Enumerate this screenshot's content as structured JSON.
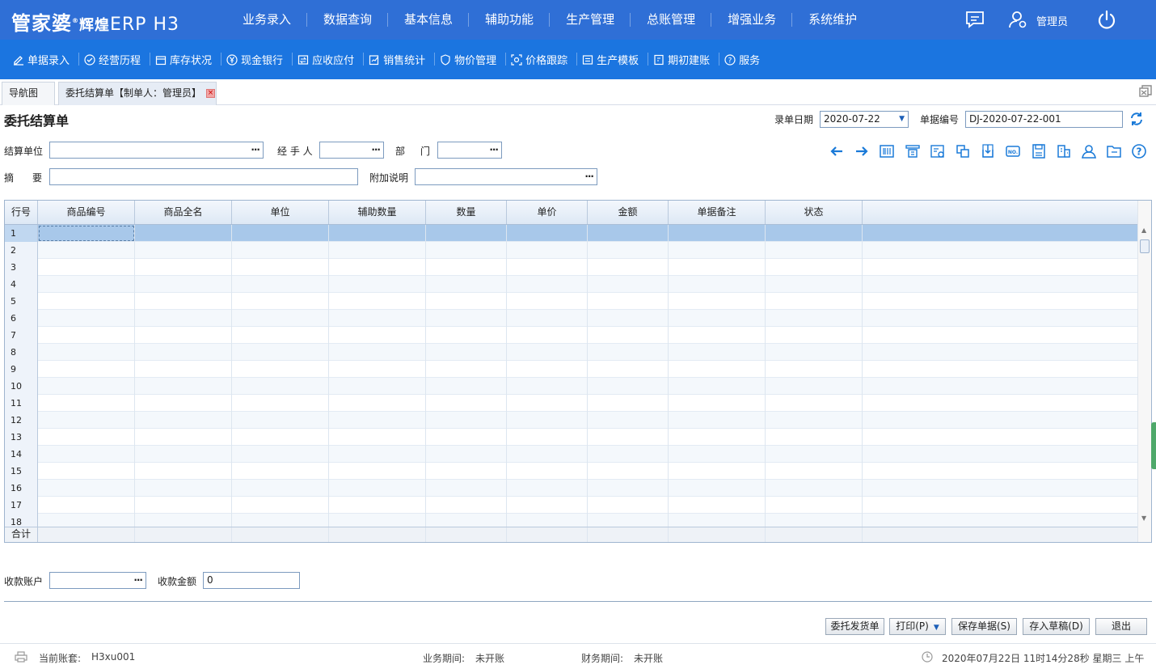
{
  "app": {
    "logo_cn": "管家婆",
    "logo_cn2": "辉煌",
    "logo_erp": "ERP H3",
    "user": "管理员"
  },
  "mainmenu": [
    "业务录入",
    "数据查询",
    "基本信息",
    "辅助功能",
    "生产管理",
    "总账管理",
    "增强业务",
    "系统维护"
  ],
  "toolbar": [
    {
      "label": "单据录入",
      "icon": "edit-icon"
    },
    {
      "label": "经营历程",
      "icon": "check-circle-icon"
    },
    {
      "label": "库存状况",
      "icon": "box-icon"
    },
    {
      "label": "现金银行",
      "icon": "yen-circle-icon"
    },
    {
      "label": "应收应付",
      "icon": "exchange-icon"
    },
    {
      "label": "销售统计",
      "icon": "chart-edit-icon"
    },
    {
      "label": "物价管理",
      "icon": "shield-icon"
    },
    {
      "label": "价格跟踪",
      "icon": "target-icon"
    },
    {
      "label": "生产模板",
      "icon": "template-icon"
    },
    {
      "label": "期初建账",
      "icon": "ledger-icon"
    },
    {
      "label": "服务",
      "icon": "help-icon"
    }
  ],
  "tabs": {
    "nav": "导航图",
    "doc": "委托结算单【制单人：管理员】"
  },
  "form": {
    "title": "委托结算单",
    "date_label": "录单日期",
    "date_value": "2020-07-22",
    "no_label": "单据编号",
    "no_value": "DJ-2020-07-22-001",
    "unit_label": "结算单位",
    "unit_value": "",
    "handler_label": "经 手 人",
    "handler_value": "",
    "dept_label1": "部",
    "dept_label2": "门",
    "dept_value": "",
    "summary_label1": "摘",
    "summary_label2": "要",
    "summary_value": "",
    "note_label": "附加说明",
    "note_value": "",
    "account_label": "收款账户",
    "account_value": "",
    "amount_label": "收款金额",
    "amount_value": "0"
  },
  "grid": {
    "columns": [
      "行号",
      "商品编号",
      "商品全名",
      "单位",
      "辅助数量",
      "数量",
      "单价",
      "金额",
      "单据备注",
      "状态"
    ],
    "rows": [
      "1",
      "2",
      "3",
      "4",
      "5",
      "6",
      "7",
      "8",
      "9",
      "10",
      "11",
      "12",
      "13",
      "14",
      "15",
      "16",
      "17",
      "18"
    ],
    "footer": "合计"
  },
  "buttons": {
    "consign": "委托发货单",
    "print": "打印(P)",
    "save": "保存单据(S)",
    "draft": "存入草稿(D)",
    "exit": "退出"
  },
  "status": {
    "account_label": "当前账套:",
    "account_value": "H3xu001",
    "biz_label": "业务期间:",
    "biz_value": "未开账",
    "fin_label": "财务期间:",
    "fin_value": "未开账",
    "datetime": "2020年07月22日 11时14分28秒 星期三 上午"
  },
  "colors": {
    "header": "#2f6fd6",
    "toolbar": "#1b75e0",
    "icon": "#1a7ad8",
    "selected_row": "#a8c8ea"
  }
}
